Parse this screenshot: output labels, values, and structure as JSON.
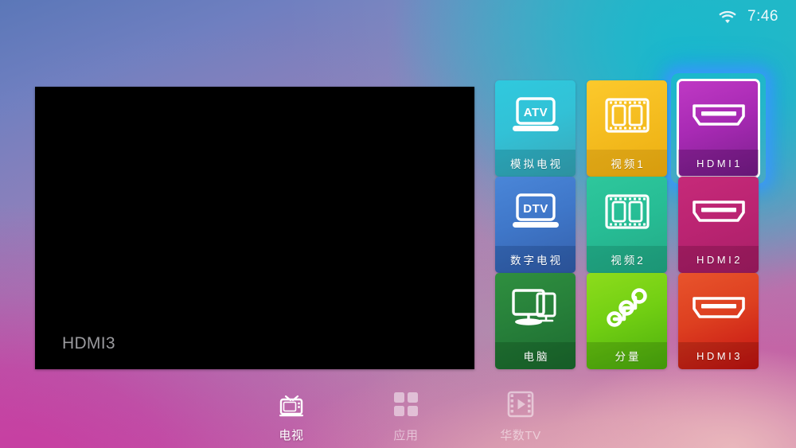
{
  "status_bar": {
    "wifi_icon": "wifi-icon",
    "time": "7:46"
  },
  "preview": {
    "label": "HDMI3",
    "background_color": "#000000"
  },
  "source_grid": {
    "selected_id": "hdmi1",
    "tiles": [
      {
        "id": "atv",
        "label": "模拟电视",
        "icon": "laptop-atv-icon",
        "icon_text": "ATV",
        "theme": "t-atv",
        "latin": false,
        "selected": false
      },
      {
        "id": "av1",
        "label": "视频1",
        "icon": "film-strip-icon",
        "icon_text": "",
        "theme": "t-av1",
        "latin": false,
        "selected": false
      },
      {
        "id": "hdmi1",
        "label": "HDMI1",
        "icon": "hdmi-connector-icon",
        "icon_text": "",
        "theme": "t-hdmi1",
        "latin": true,
        "selected": true
      },
      {
        "id": "dtv",
        "label": "数字电视",
        "icon": "laptop-dtv-icon",
        "icon_text": "DTV",
        "theme": "t-dtv",
        "latin": false,
        "selected": false
      },
      {
        "id": "av2",
        "label": "视频2",
        "icon": "film-strip-icon",
        "icon_text": "",
        "theme": "t-av2",
        "latin": false,
        "selected": false
      },
      {
        "id": "hdmi2",
        "label": "HDMI2",
        "icon": "hdmi-connector-icon",
        "icon_text": "",
        "theme": "t-hdmi2",
        "latin": true,
        "selected": false
      },
      {
        "id": "pc",
        "label": "电脑",
        "icon": "dual-monitor-icon",
        "icon_text": "",
        "theme": "t-pc",
        "latin": false,
        "selected": false
      },
      {
        "id": "comp",
        "label": "分量",
        "icon": "component-nodes-icon",
        "icon_text": "",
        "theme": "t-comp",
        "latin": false,
        "selected": false
      },
      {
        "id": "hdmi3",
        "label": "HDMI3",
        "icon": "hdmi-connector-icon",
        "icon_text": "",
        "theme": "t-hdmi3",
        "latin": true,
        "selected": false
      }
    ]
  },
  "bottom_nav": {
    "items": [
      {
        "id": "tv",
        "label": "电视",
        "icon": "tv-set-icon",
        "active": true
      },
      {
        "id": "apps",
        "label": "应用",
        "icon": "grid-apps-icon",
        "active": false
      },
      {
        "id": "wasu",
        "label": "华数TV",
        "icon": "video-play-icon",
        "active": false
      }
    ]
  },
  "colors": {
    "focus_border": "#ffffff",
    "focus_glow": "#3c96ff",
    "bg_top_left": "#5b77b8",
    "bg_top_right": "#1abec4",
    "bg_bottom_left": "#c73da1",
    "bg_bottom_right": "#e8b2b8"
  }
}
